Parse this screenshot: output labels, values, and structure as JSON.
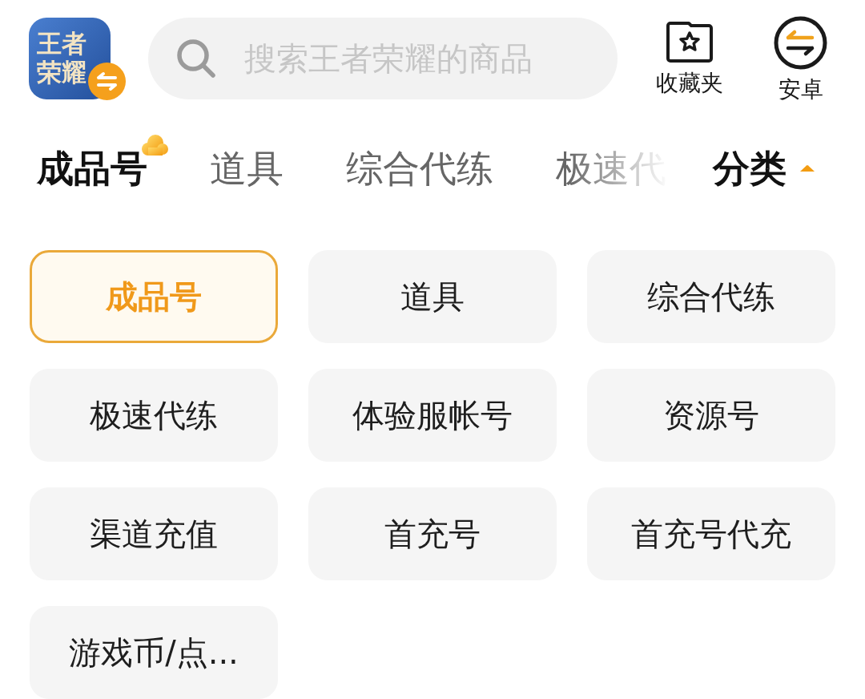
{
  "header": {
    "logo": {
      "text": "王者荣耀"
    },
    "search": {
      "placeholder": "搜索王者荣耀的商品"
    },
    "actions": [
      {
        "kind": "favorites",
        "label": "收藏夹"
      },
      {
        "kind": "platform",
        "label": "安卓"
      }
    ]
  },
  "tabs": [
    {
      "label": "成品号",
      "selected": true
    },
    {
      "label": "道具",
      "selected": false
    },
    {
      "label": "综合代练",
      "selected": false
    },
    {
      "label": "极速代",
      "selected": false
    }
  ],
  "category_toggle": {
    "label": "分类",
    "expanded": true
  },
  "categories": [
    {
      "label": "成品号",
      "selected": true
    },
    {
      "label": "道具",
      "selected": false
    },
    {
      "label": "综合代练",
      "selected": false
    },
    {
      "label": "极速代练",
      "selected": false
    },
    {
      "label": "体验服帐号",
      "selected": false
    },
    {
      "label": "资源号",
      "selected": false
    },
    {
      "label": "渠道充值",
      "selected": false
    },
    {
      "label": "首充号",
      "selected": false
    },
    {
      "label": "首充号代充",
      "selected": false
    },
    {
      "label": "游戏币/点...",
      "selected": false
    }
  ]
}
